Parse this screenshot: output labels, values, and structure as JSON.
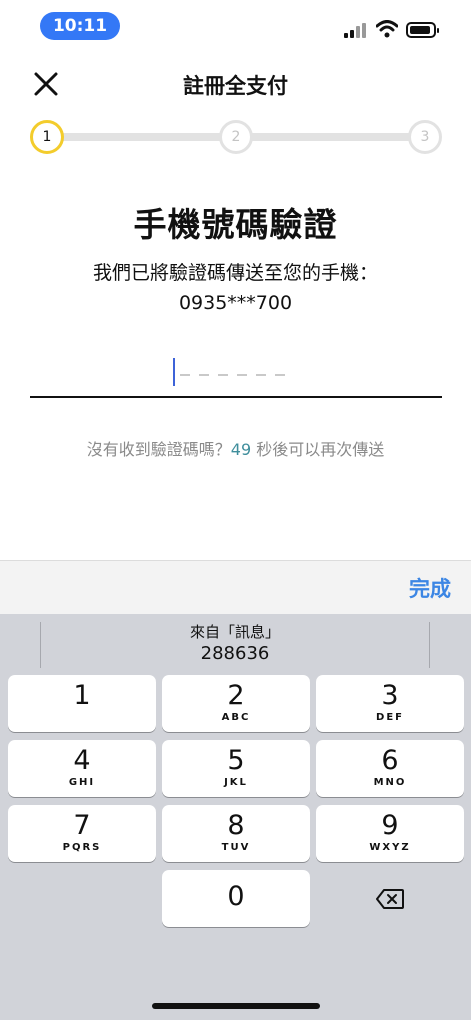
{
  "status_bar": {
    "time": "10:11"
  },
  "header": {
    "title": "註冊全支付",
    "close_icon": "close-icon"
  },
  "stepper": {
    "steps": [
      "1",
      "2",
      "3"
    ],
    "current": 1
  },
  "main": {
    "title": "手機號碼驗證",
    "subtitle_line1": "我們已將驗證碼傳送至您的手機：",
    "phone": "0935***700",
    "code_value": ""
  },
  "resend": {
    "prefix": "沒有收到驗證碼嗎？",
    "countdown": "49",
    "suffix": " 秒後可以再次傳送"
  },
  "toolbar": {
    "done_label": "完成"
  },
  "keyboard": {
    "suggestion_source": "來自「訊息」",
    "suggestion_code": "288636",
    "keys": [
      {
        "digit": "1",
        "letters": ""
      },
      {
        "digit": "2",
        "letters": "ABC"
      },
      {
        "digit": "3",
        "letters": "DEF"
      },
      {
        "digit": "4",
        "letters": "GHI"
      },
      {
        "digit": "5",
        "letters": "JKL"
      },
      {
        "digit": "6",
        "letters": "MNO"
      },
      {
        "digit": "7",
        "letters": "PQRS"
      },
      {
        "digit": "8",
        "letters": "TUV"
      },
      {
        "digit": "9",
        "letters": "WXYZ"
      },
      {
        "digit": "0",
        "letters": ""
      }
    ]
  },
  "colors": {
    "accent_blue": "#3c86e4",
    "step_active": "#f3cc2c",
    "countdown": "#3f8e9c",
    "time_pill": "#3478f6"
  }
}
